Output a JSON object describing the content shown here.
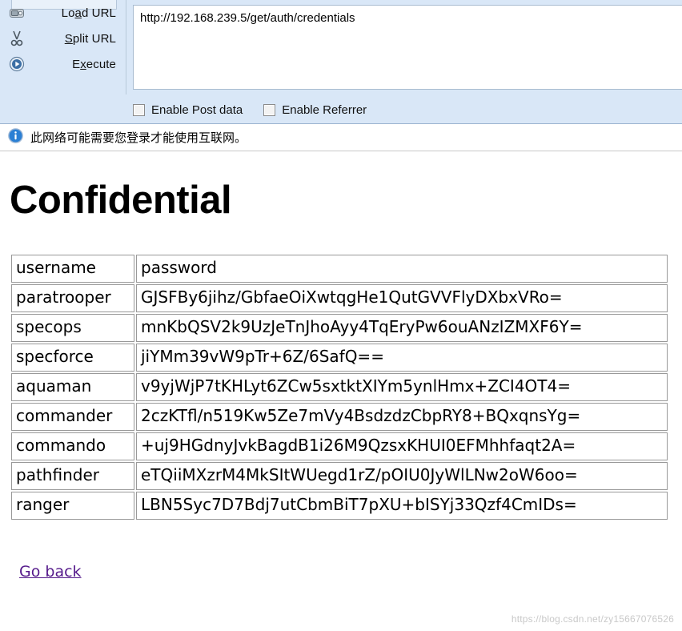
{
  "hackbar": {
    "commands": [
      {
        "icon": "load-url-icon",
        "label_pre": "Lo",
        "label_accel": "a",
        "label_post": "d URL",
        "name": "load-url"
      },
      {
        "icon": "split-url-icon",
        "label_pre": "",
        "label_accel": "S",
        "label_post": "plit URL",
        "name": "split-url"
      },
      {
        "icon": "execute-icon",
        "label_pre": "E",
        "label_accel": "x",
        "label_post": "ecute",
        "name": "execute"
      }
    ],
    "url_value": "http://192.168.239.5/get/auth/credentials",
    "url_placeholder": "",
    "checkboxes": [
      {
        "label": "Enable Post data",
        "checked": false,
        "name": "enable-post-data"
      },
      {
        "label": "Enable Referrer",
        "checked": false,
        "name": "enable-referrer"
      }
    ]
  },
  "notification": {
    "icon": "info-icon",
    "text": "此网络可能需要您登录才能使用互联网。"
  },
  "page": {
    "title": "Confidential",
    "go_back_label": "Go back",
    "watermark": "https://blog.csdn.net/zy15667076526"
  },
  "table": {
    "headers": [
      "username",
      "password"
    ],
    "rows": [
      [
        "paratrooper",
        "GJSFBy6jihz/GbfaeOiXwtqgHe1QutGVVFlyDXbxVRo="
      ],
      [
        "specops",
        "mnKbQSV2k9UzJeTnJhoAyy4TqEryPw6ouANzIZMXF6Y="
      ],
      [
        "specforce",
        "jiYMm39vW9pTr+6Z/6SafQ=="
      ],
      [
        "aquaman",
        "v9yjWjP7tKHLyt6ZCw5sxtktXIYm5ynlHmx+ZCI4OT4="
      ],
      [
        "commander",
        "2czKTfl/n519Kw5Ze7mVy4BsdzdzCbpRY8+BQxqnsYg="
      ],
      [
        "commando",
        "+uj9HGdnyJvkBagdB1i26M9QzsxKHUI0EFMhhfaqt2A="
      ],
      [
        "pathfinder",
        "eTQiiMXzrM4MkSItWUegd1rZ/pOIU0JyWlLNw2oW6oo="
      ],
      [
        "ranger",
        "LBN5Syc7D7Bdj7utCbmBiT7pXU+bISYj33Qzf4CmIDs="
      ]
    ]
  },
  "colors": {
    "toolbar_bg": "#d9e7f7",
    "link": "#551a8b",
    "info_blue": "#2a7fd4"
  }
}
